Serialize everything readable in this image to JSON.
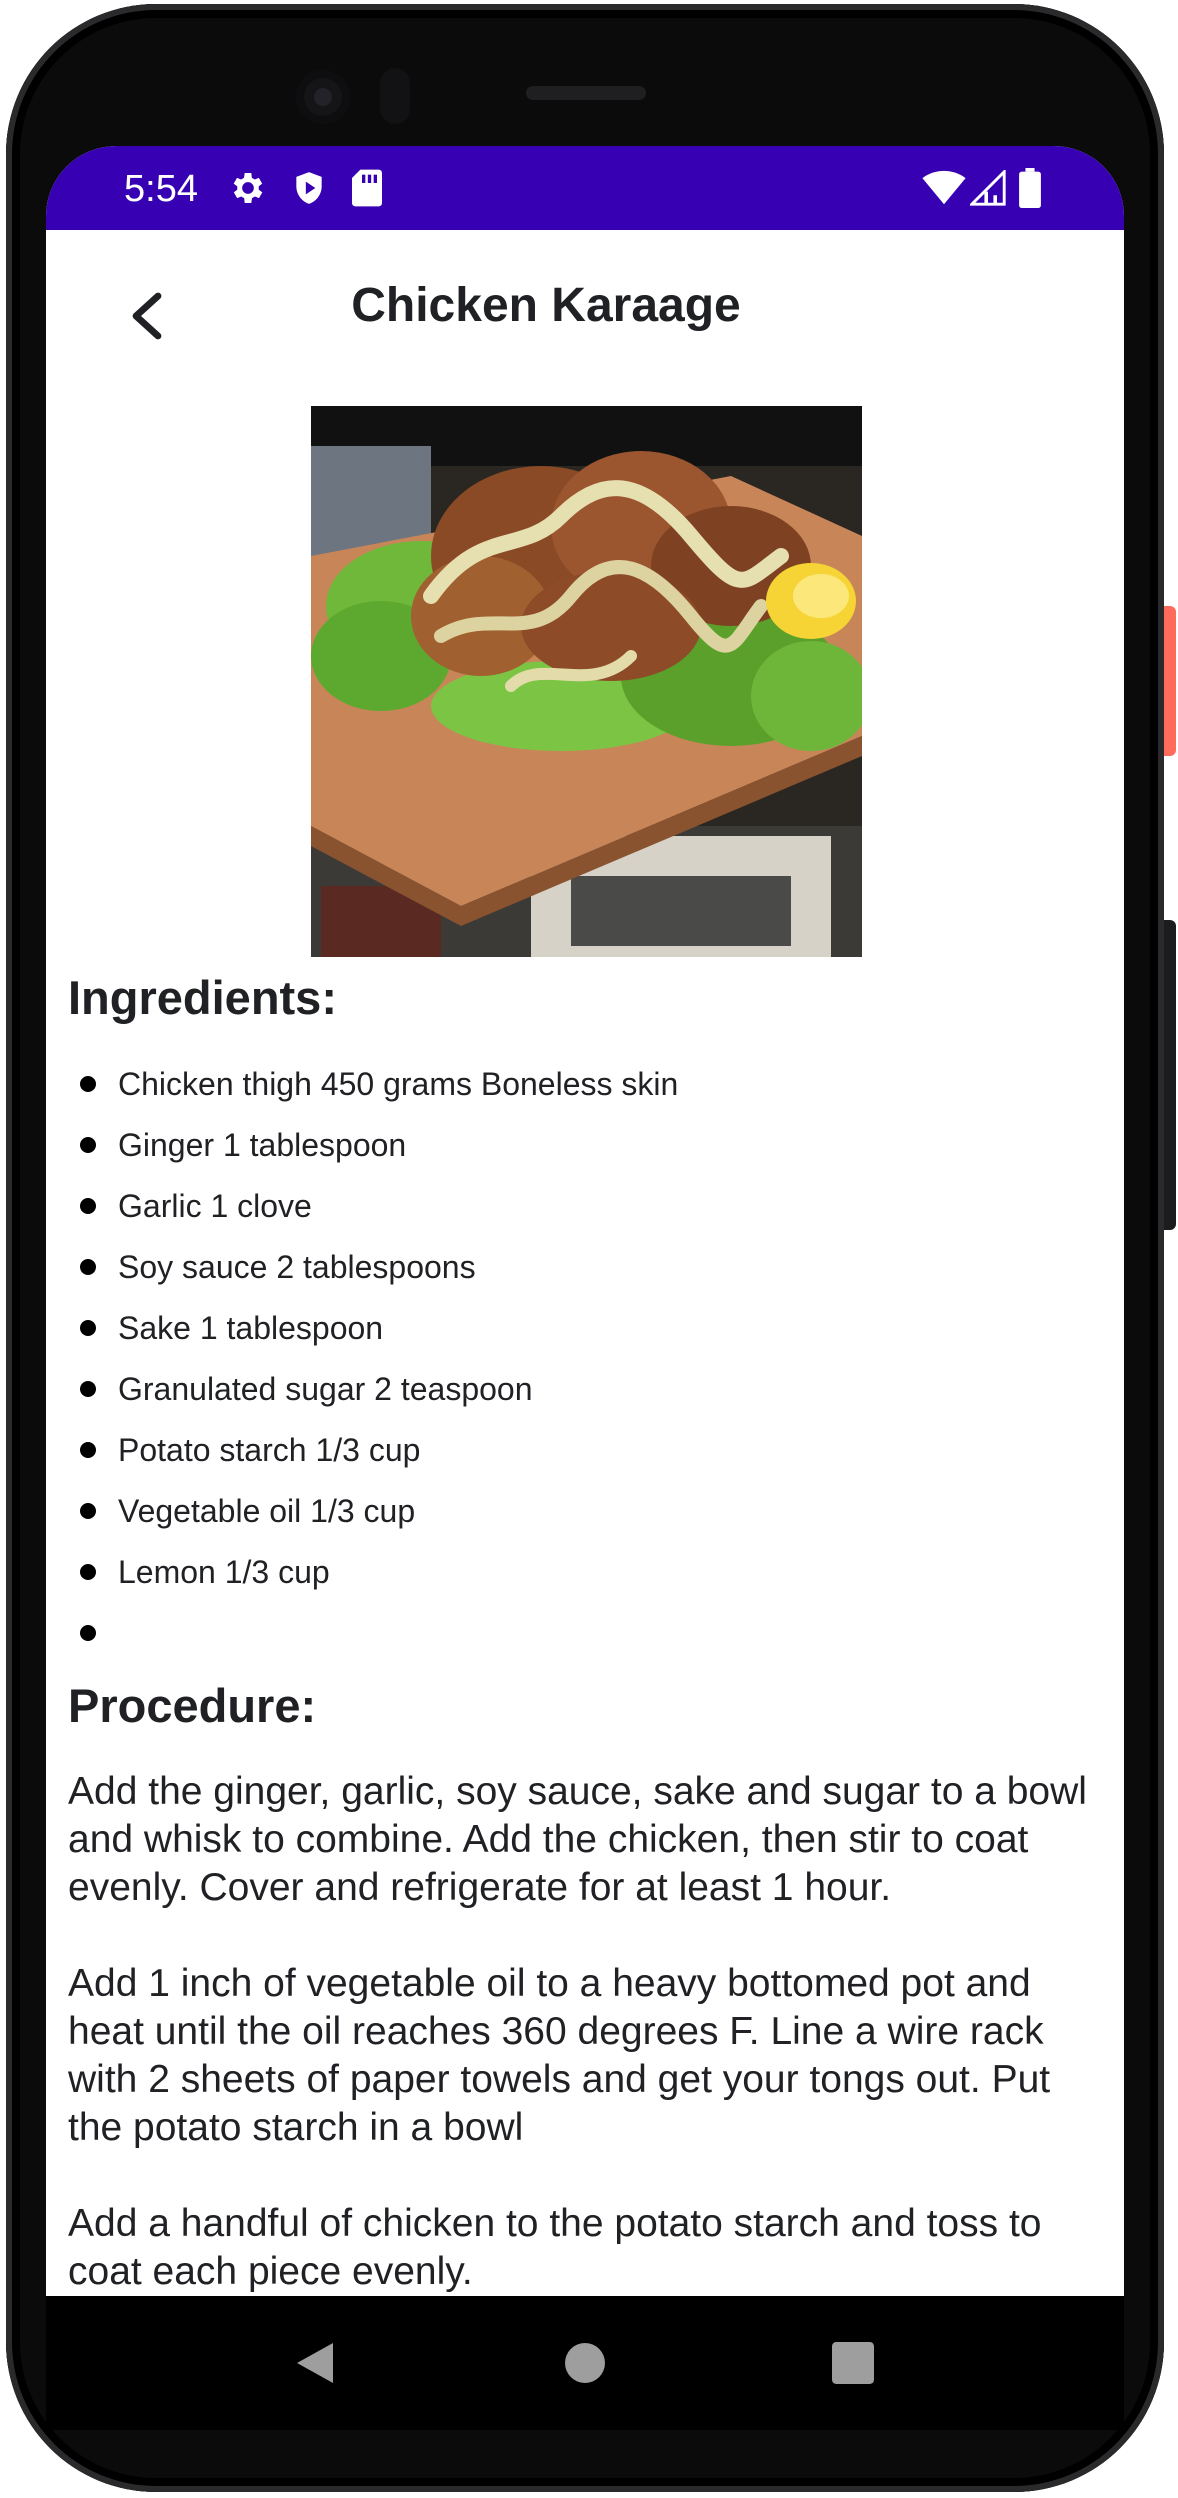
{
  "status_bar": {
    "time": "5:54",
    "left_icons": [
      "gear-icon",
      "shield-icon",
      "sd-card-icon"
    ],
    "right_icons": [
      "wifi-icon",
      "cell-signal-icon",
      "battery-icon"
    ],
    "color": "#3700b3"
  },
  "header": {
    "title": "Chicken Karaage",
    "back_icon": "chevron-left-icon"
  },
  "photo": {
    "description_icon": "food-photo"
  },
  "ingredients": {
    "heading": "Ingredients:",
    "items": [
      "Chicken thigh 450 grams Boneless skin",
      "Ginger 1 tablespoon",
      "Garlic 1 clove",
      "Soy sauce 2 tablespoons",
      "Sake 1 tablespoon",
      "Granulated sugar 2 teaspoon",
      "Potato starch 1/3 cup",
      "Vegetable oil 1/3 cup",
      "Lemon 1/3 cup",
      ""
    ]
  },
  "procedure": {
    "heading": "Procedure:",
    "text": "Add the ginger, garlic, soy sauce, sake and sugar to a bowl and whisk to combine. Add the chicken, then stir to coat evenly. Cover and refrigerate for at least 1 hour.\n\nAdd 1 inch of vegetable oil to a heavy bottomed pot and heat until the oil reaches 360 degrees F. Line a wire rack with 2 sheets of paper towels and get your tongs out. Put the potato starch in a bowl\n\nAdd a handful of chicken to the potato starch and toss to coat each piece evenly."
  },
  "nav_bar": {
    "buttons": [
      "back-triangle-icon",
      "home-circle-icon",
      "recents-square-icon"
    ]
  }
}
